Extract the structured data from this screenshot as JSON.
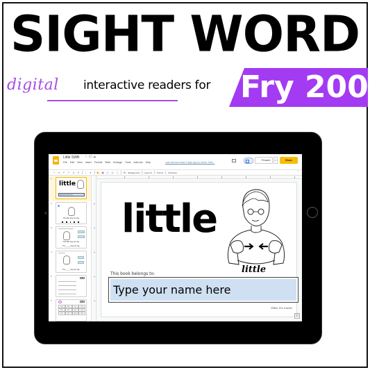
{
  "banner": {
    "headline": "SIGHT WORD",
    "digital": "digital",
    "tagline": "interactive readers for",
    "badge": "Fry 200",
    "accent_color": "#a33bf2"
  },
  "slides_app": {
    "doc_title": "Little SWB",
    "title_icons": "☆ ⊡ ☁",
    "menu": [
      "File",
      "Edit",
      "View",
      "Insert",
      "Format",
      "Slide",
      "Arrange",
      "Tools",
      "Add-ons",
      "Help"
    ],
    "last_edit": "Last edit was made 3 days ago by Jessie Yarbr...",
    "present_label": "Present",
    "share_label": "Share",
    "toolbar_labels": {
      "background": "Background",
      "layout": "Layout ▾",
      "theme": "Theme",
      "transition": "Transition"
    },
    "share_color": "#fbbc04"
  },
  "filmstrip": {
    "slides": [
      {
        "num": "1",
        "word": "little",
        "box": "Type your name here"
      },
      {
        "num": "2",
        "sentence": "The little dog can dig."
      },
      {
        "num": "3",
        "sentence": "The little dog can dig.",
        "sentence2": "The ____ dog can dig.",
        "tag": "little"
      },
      {
        "num": "4",
        "sentence": "The ____ dog can dig."
      },
      {
        "num": "5",
        "tag": "little"
      },
      {
        "num": "6",
        "tag": "little",
        "grid": [
          "jump",
          "little",
          "big",
          "blue",
          "little",
          "little",
          "little",
          "come",
          "and",
          "little",
          "yellow",
          "little"
        ]
      }
    ]
  },
  "slide": {
    "word": "little",
    "asl_caption": "little",
    "belongs_label": "This book belongs to:",
    "name_placeholder": "Type your name here",
    "credit": "©Mrs. D's Corner"
  }
}
